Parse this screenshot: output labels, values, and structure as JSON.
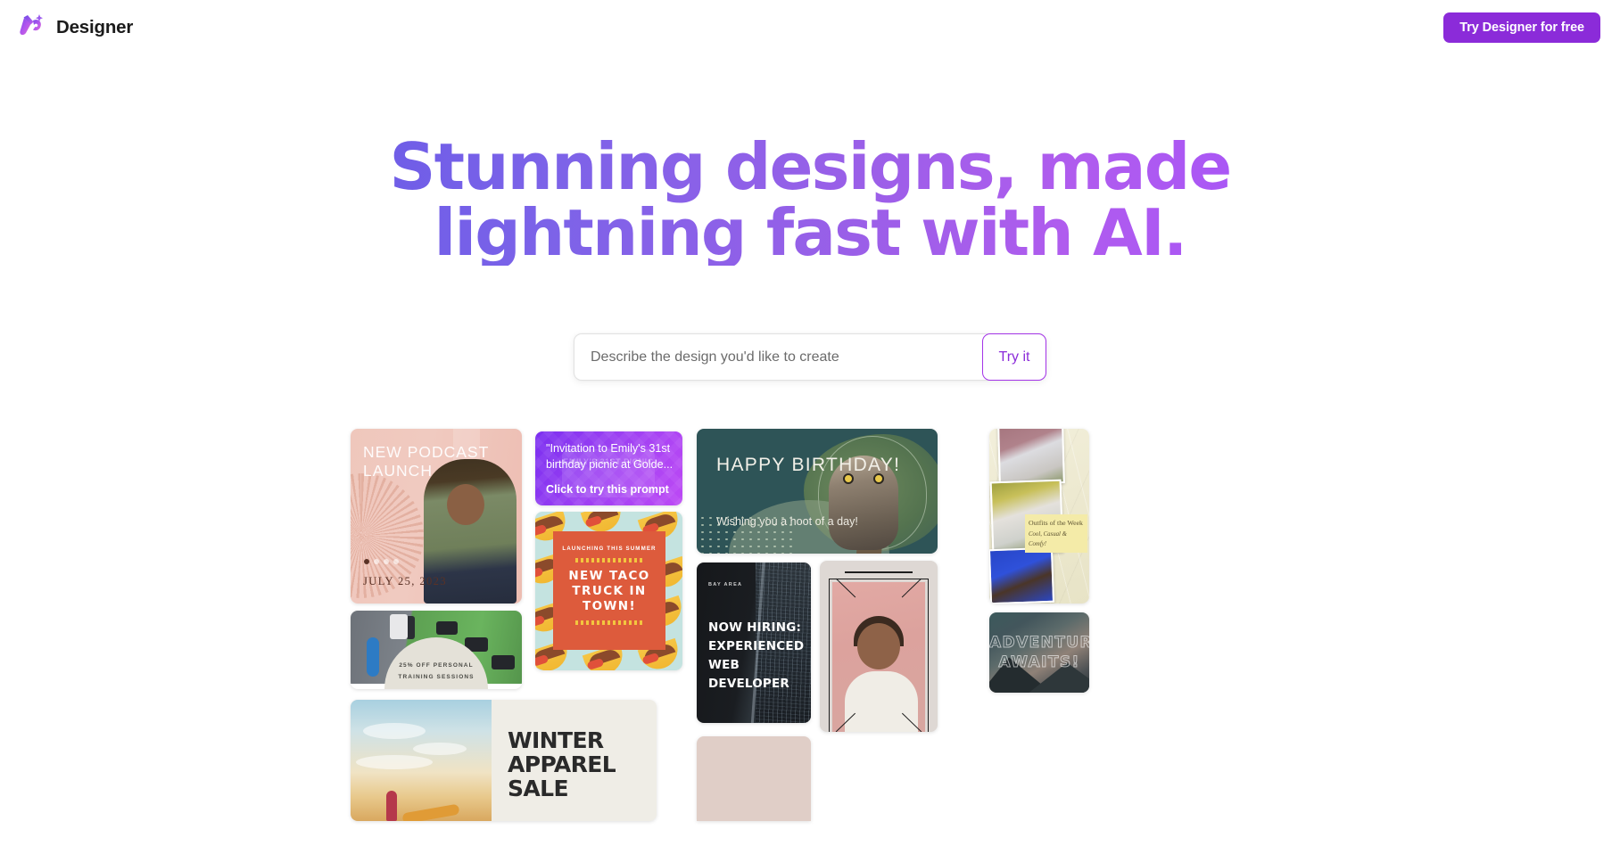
{
  "header": {
    "logo_icon": "designer-brush-icon",
    "brand_name": "Designer",
    "cta_label": "Try Designer for free",
    "cta_color": "#8B2BD9"
  },
  "hero": {
    "headline_line1": "Stunning designs, made lightning",
    "headline_line2": "fast with AI.",
    "gradient_start": "#6C5CE7",
    "gradient_end": "#A855F7"
  },
  "prompt": {
    "placeholder": "Describe the design you'd like to create",
    "value": "",
    "button_label": "Try it",
    "button_border_color": "#A435E8"
  },
  "gallery": {
    "podcast": {
      "title": "NEW PODCAST LAUNCH",
      "date": "JULY 25, 2023"
    },
    "prompt_card": {
      "quote": "\"Invitation to Emily's 31st birthday picnic at Golde...",
      "cta": "Click to try this prompt",
      "ghost_text": "EMILY'S 31ST PICNIC"
    },
    "taco": {
      "kicker": "LAUNCHING THIS SUMMER",
      "title": "NEW TACO TRUCK IN TOWN!",
      "box_color": "#DD5B3C",
      "bg_color": "#C4E3E0"
    },
    "fitness": {
      "caption_line1": "25% OFF PERSONAL",
      "caption_line2": "TRAINING SESSIONS"
    },
    "owl": {
      "title": "HAPPY BIRTHDAY!",
      "subtitle": "Wishing you a hoot of a day!",
      "bg_color": "#2E5457"
    },
    "hiring": {
      "kicker": "BAY AREA",
      "title_line1": "NOW HIRING:",
      "title_line2": "EXPERIENCED",
      "title_line3": "WEB DEVELOPER"
    },
    "baby": {
      "alt": "baby portrait with decorative frame"
    },
    "winter": {
      "title_line1": "WINTER",
      "title_line2": "APPAREL",
      "title_line3": "SALE"
    },
    "fashion": {
      "label_title": "Outfits of the Week",
      "label_sub": "Cool, Casual & Comfy!"
    },
    "adventure": {
      "title_line1": "ADVENTURE",
      "title_line2": "AWAITS!"
    }
  }
}
